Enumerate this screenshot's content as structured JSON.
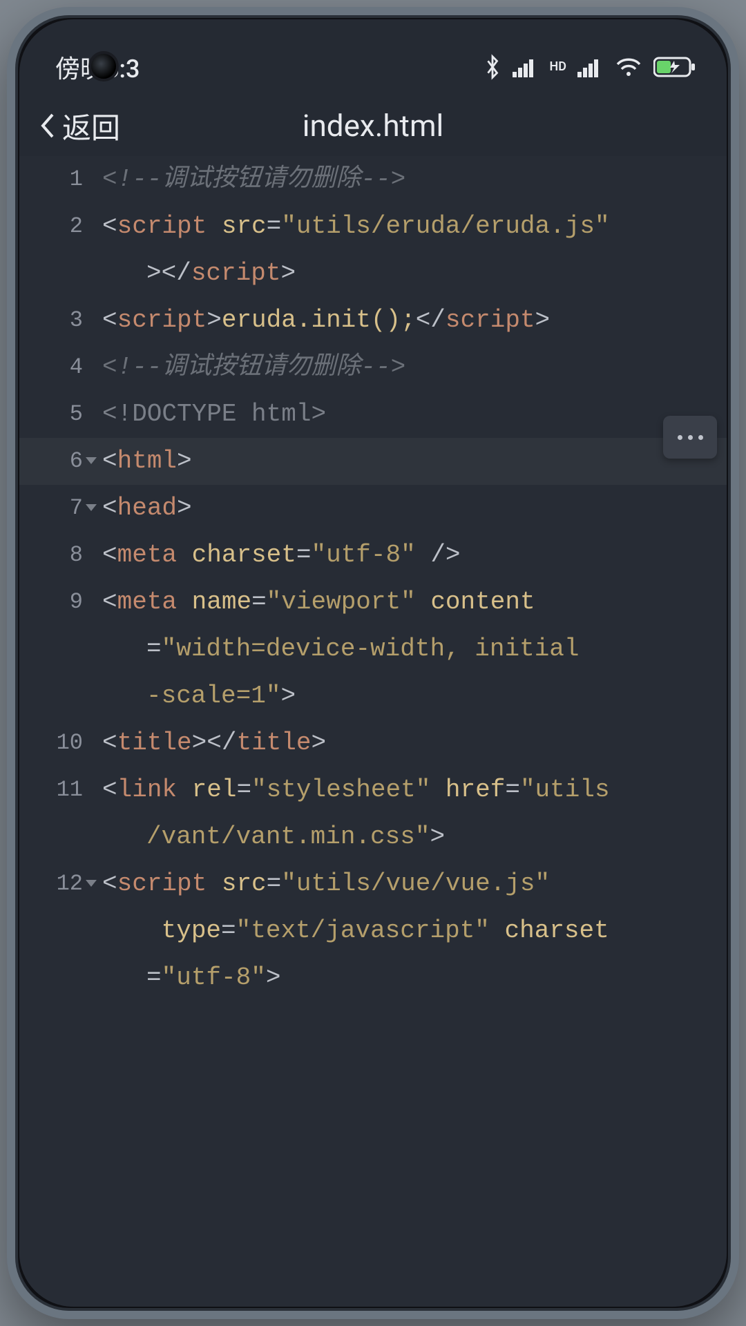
{
  "statusbar": {
    "time": "傍晚6:3"
  },
  "header": {
    "back_label": "返回",
    "title": "index.html"
  },
  "syntax_colors": {
    "comment": "#6b7078",
    "tag": "#c58a6e",
    "attr": "#d8c08a",
    "string": "#b59f6b",
    "doctype": "#7a7f88"
  },
  "code": {
    "active_line": 6,
    "lines": [
      {
        "n": 1,
        "fold": false,
        "tokens": [
          {
            "t": "comment",
            "v": "<!--调试按钮请勿删除-->"
          }
        ]
      },
      {
        "n": 2,
        "fold": false,
        "tokens": [
          {
            "t": "punct",
            "v": "<"
          },
          {
            "t": "tag",
            "v": "script"
          },
          {
            "t": "punct",
            "v": " "
          },
          {
            "t": "attr",
            "v": "src"
          },
          {
            "t": "punct",
            "v": "="
          },
          {
            "t": "string",
            "v": "\"utils/eruda/eruda.js\""
          }
        ],
        "wrap": [
          [
            {
              "t": "punct",
              "v": ">"
            },
            {
              "t": "punct",
              "v": "</"
            },
            {
              "t": "tag",
              "v": "script"
            },
            {
              "t": "punct",
              "v": ">"
            }
          ]
        ]
      },
      {
        "n": 3,
        "fold": false,
        "tokens": [
          {
            "t": "punct",
            "v": "<"
          },
          {
            "t": "tag",
            "v": "script"
          },
          {
            "t": "punct",
            "v": ">"
          },
          {
            "t": "text",
            "v": "eruda.init();"
          },
          {
            "t": "punct",
            "v": "</"
          },
          {
            "t": "tag",
            "v": "script"
          },
          {
            "t": "punct",
            "v": ">"
          }
        ]
      },
      {
        "n": 4,
        "fold": false,
        "tokens": [
          {
            "t": "comment",
            "v": "<!--调试按钮请勿删除-->"
          }
        ]
      },
      {
        "n": 5,
        "fold": false,
        "tokens": [
          {
            "t": "doctype",
            "v": "<!DOCTYPE html>"
          }
        ]
      },
      {
        "n": 6,
        "fold": true,
        "tokens": [
          {
            "t": "punct",
            "v": "<"
          },
          {
            "t": "tag",
            "v": "html"
          },
          {
            "t": "punct",
            "v": ">"
          }
        ]
      },
      {
        "n": 7,
        "fold": true,
        "tokens": [
          {
            "t": "punct",
            "v": "<"
          },
          {
            "t": "tag",
            "v": "head"
          },
          {
            "t": "punct",
            "v": ">"
          }
        ]
      },
      {
        "n": 8,
        "fold": false,
        "tokens": [
          {
            "t": "punct",
            "v": "<"
          },
          {
            "t": "tag",
            "v": "meta"
          },
          {
            "t": "punct",
            "v": " "
          },
          {
            "t": "attr",
            "v": "charset"
          },
          {
            "t": "punct",
            "v": "="
          },
          {
            "t": "string",
            "v": "\"utf-8\""
          },
          {
            "t": "punct",
            "v": " />"
          }
        ]
      },
      {
        "n": 9,
        "fold": false,
        "tokens": [
          {
            "t": "punct",
            "v": "<"
          },
          {
            "t": "tag",
            "v": "meta"
          },
          {
            "t": "punct",
            "v": " "
          },
          {
            "t": "attr",
            "v": "name"
          },
          {
            "t": "punct",
            "v": "="
          },
          {
            "t": "string",
            "v": "\"viewport\""
          },
          {
            "t": "punct",
            "v": " "
          },
          {
            "t": "attr",
            "v": "content"
          }
        ],
        "wrap": [
          [
            {
              "t": "punct",
              "v": "="
            },
            {
              "t": "string",
              "v": "\"width=device-width, initial"
            }
          ],
          [
            {
              "t": "string",
              "v": "-scale=1\""
            },
            {
              "t": "punct",
              "v": ">"
            }
          ]
        ]
      },
      {
        "n": 10,
        "fold": false,
        "tokens": [
          {
            "t": "punct",
            "v": "<"
          },
          {
            "t": "tag",
            "v": "title"
          },
          {
            "t": "punct",
            "v": ">"
          },
          {
            "t": "punct",
            "v": "</"
          },
          {
            "t": "tag",
            "v": "title"
          },
          {
            "t": "punct",
            "v": ">"
          }
        ]
      },
      {
        "n": 11,
        "fold": false,
        "tokens": [
          {
            "t": "punct",
            "v": "<"
          },
          {
            "t": "tag",
            "v": "link"
          },
          {
            "t": "punct",
            "v": " "
          },
          {
            "t": "attr",
            "v": "rel"
          },
          {
            "t": "punct",
            "v": "="
          },
          {
            "t": "string",
            "v": "\"stylesheet\""
          },
          {
            "t": "punct",
            "v": " "
          },
          {
            "t": "attr",
            "v": "href"
          },
          {
            "t": "punct",
            "v": "="
          },
          {
            "t": "string",
            "v": "\"utils"
          }
        ],
        "wrap": [
          [
            {
              "t": "string",
              "v": "/vant/vant.min.css\""
            },
            {
              "t": "punct",
              "v": ">"
            }
          ]
        ]
      },
      {
        "n": 12,
        "fold": true,
        "tokens": [
          {
            "t": "punct",
            "v": "<"
          },
          {
            "t": "tag",
            "v": "script"
          },
          {
            "t": "punct",
            "v": " "
          },
          {
            "t": "attr",
            "v": "src"
          },
          {
            "t": "punct",
            "v": "="
          },
          {
            "t": "string",
            "v": "\"utils/vue/vue.js\""
          }
        ],
        "wrap": [
          [
            {
              "t": "punct",
              "v": " "
            },
            {
              "t": "attr",
              "v": "type"
            },
            {
              "t": "punct",
              "v": "="
            },
            {
              "t": "string",
              "v": "\"text/javascript\""
            },
            {
              "t": "punct",
              "v": " "
            },
            {
              "t": "attr",
              "v": "charset"
            }
          ],
          [
            {
              "t": "punct",
              "v": "="
            },
            {
              "t": "string",
              "v": "\"utf-8\""
            },
            {
              "t": "punct",
              "v": ">"
            }
          ]
        ]
      }
    ]
  }
}
